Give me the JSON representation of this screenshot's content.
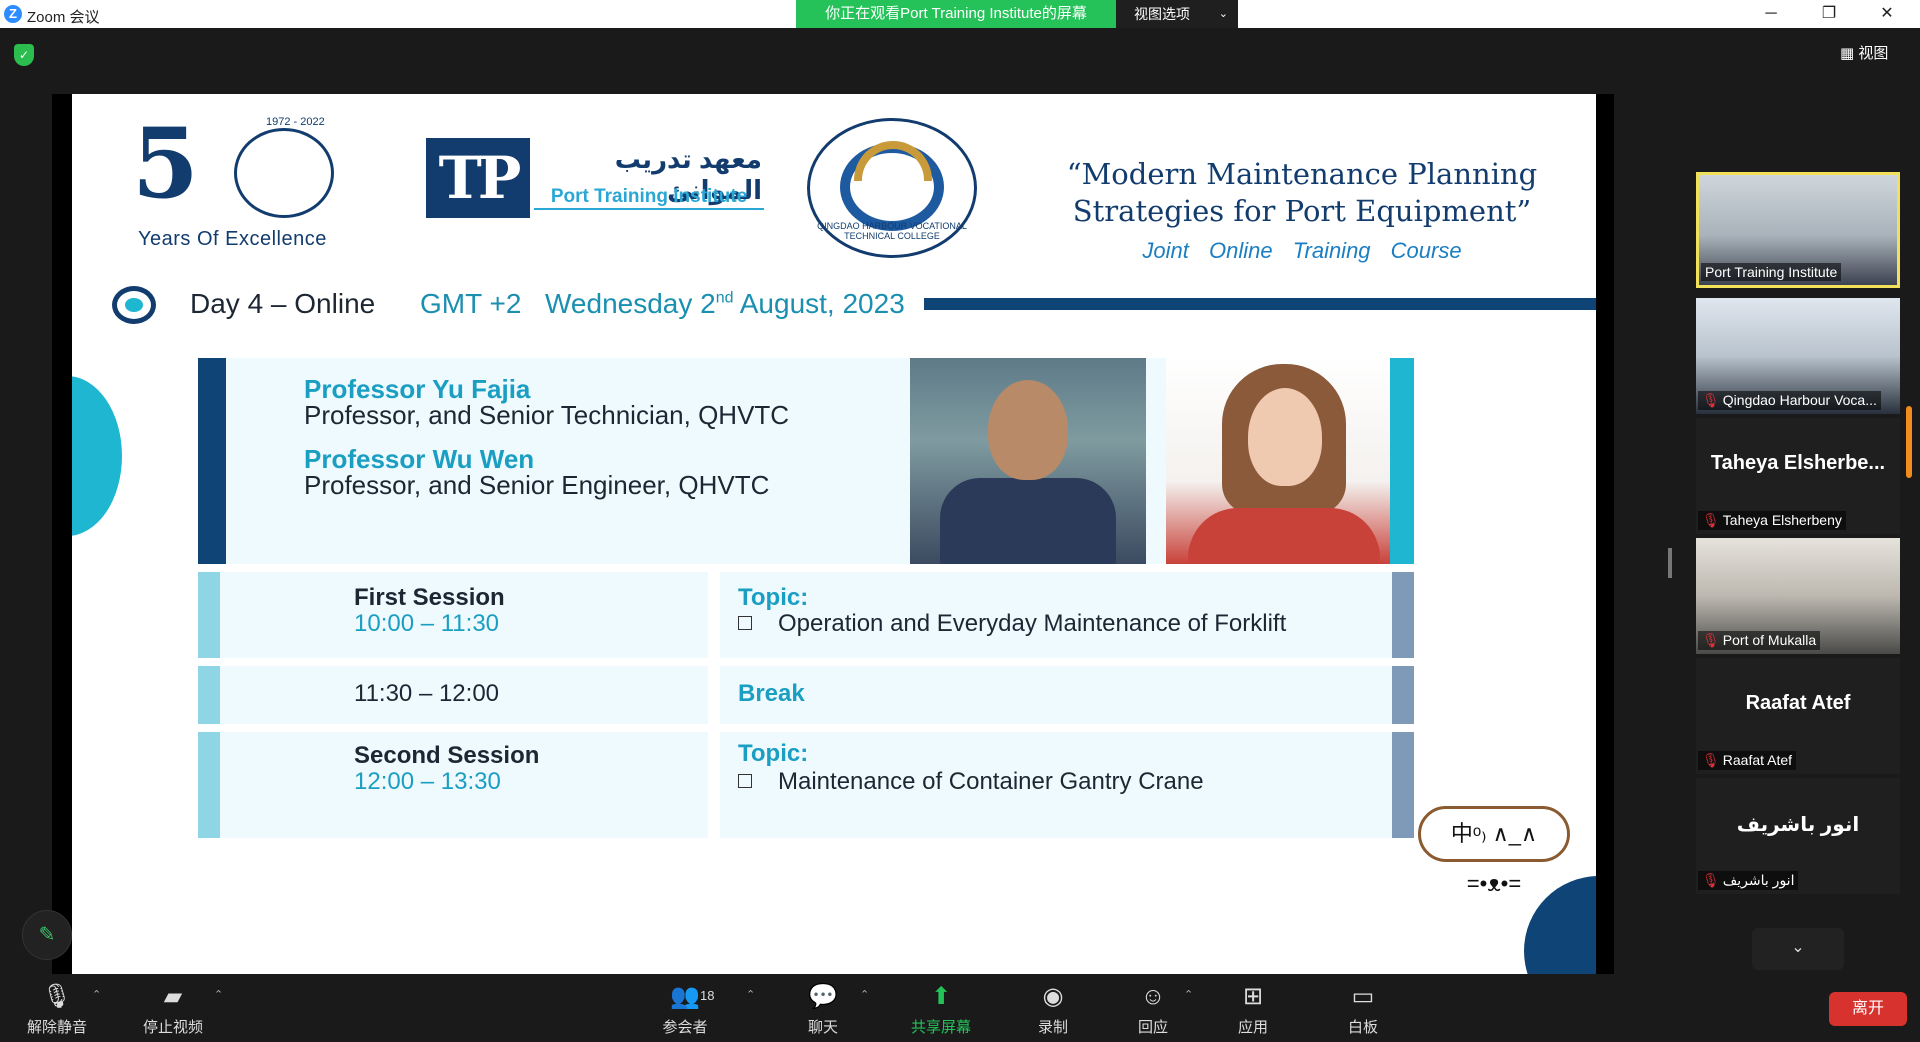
{
  "window": {
    "app_title": "Zoom 会议",
    "share_banner": "你正在观看Port Training Institute的屏幕",
    "view_options": "视图选项",
    "controls": {
      "minimize": "─",
      "restore": "❐",
      "close": "✕"
    }
  },
  "meeting": {
    "view_button": "视图"
  },
  "slide": {
    "logo50_tag": "Years Of Excellence",
    "logo50_years": "1972 - 2022",
    "logo50_number": "5",
    "pti_arabic": "معهد تدريب الموانئ",
    "pti_english": "Port Training Institute",
    "qhvtc_ring": "QINGDAO HARBOUR VOCATIONAL TECHNICAL COLLEGE",
    "course_title_line1": "“Modern Maintenance Planning",
    "course_title_line2": "Strategies for Port Equipment”",
    "course_subtitle": "Joint Online Training Course",
    "day_label": "Day 4 – Online",
    "gmt": "GMT +2",
    "date_prefix": "Wednesday 2",
    "date_sup": "nd",
    "date_suffix": " August, 2023",
    "professors": [
      {
        "name": "Professor Yu Fajia",
        "role": "Professor, and Senior Technician, QHVTC"
      },
      {
        "name": "Professor Wu Wen",
        "role": "Professor, and Senior Engineer, QHVTC"
      }
    ],
    "schedule": {
      "first": {
        "title": "First Session",
        "time": "10:00 – 11:30",
        "topic_label": "Topic:",
        "topic": "Operation and Everyday Maintenance of Forklift"
      },
      "break": {
        "time": "11:30 – 12:00",
        "label": "Break"
      },
      "second": {
        "title": "Second Session",
        "time": "12:00 – 13:30",
        "topic_label": "Topic:",
        "topic": "Maintenance of Container Gantry Crane"
      }
    },
    "sticker": "中ᵒ₎ ∧_∧ =•ᴥ•="
  },
  "participants": [
    {
      "name": "Port Training Institute",
      "muted": false,
      "video": true
    },
    {
      "name": "Qingdao Harbour Voca...",
      "muted": true,
      "video": true
    },
    {
      "name": "Taheya Elsherbeny",
      "display": "Taheya Elsherbe...",
      "muted": true,
      "video": false
    },
    {
      "name": "Port of Mukalla",
      "muted": true,
      "video": true
    },
    {
      "name": "Raafat Atef",
      "display": "Raafat Atef",
      "muted": true,
      "video": false
    },
    {
      "name": "انور باشريف",
      "display": "انور باشريف",
      "muted": true,
      "video": false
    }
  ],
  "toolbar": {
    "unmute": "解除静音",
    "stop_video": "停止视频",
    "participants": "参会者",
    "participants_count": "18",
    "chat": "聊天",
    "share": "共享屏幕",
    "record": "录制",
    "reactions": "回应",
    "apps": "应用",
    "whiteboard": "白板",
    "leave": "离开"
  },
  "colors": {
    "navy": "#0f4576",
    "cyan": "#1fb6d1",
    "green": "#25c25a",
    "leave_red": "#d8322f"
  }
}
